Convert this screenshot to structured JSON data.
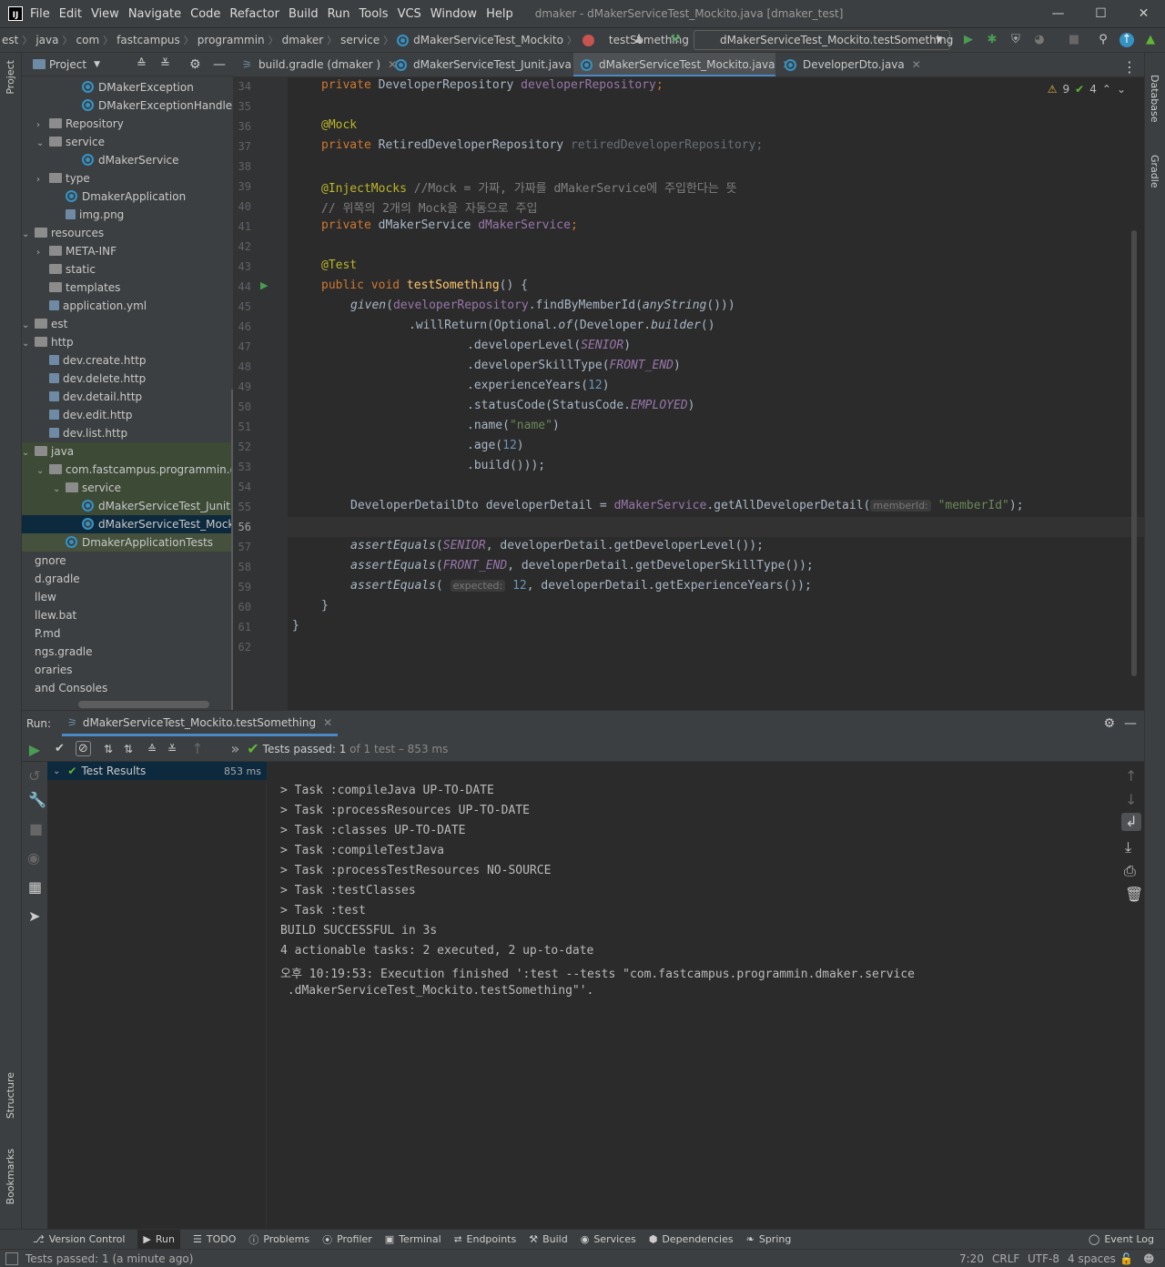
{
  "menubar": {
    "items": [
      "File",
      "Edit",
      "View",
      "Navigate",
      "Code",
      "Refactor",
      "Build",
      "Run",
      "Tools",
      "VCS",
      "Window",
      "Help"
    ],
    "title": "dmaker - dMakerServiceTest_Mockito.java [dmaker_test]"
  },
  "navbar": {
    "crumbs": [
      "est",
      "java",
      "com",
      "fastcampus",
      "programmin",
      "dmaker",
      "service",
      "dMakerServiceTest_Mockito",
      "testSomething"
    ],
    "run_config": "dMakerServiceTest_Mockito.testSomething"
  },
  "leftstrip": {
    "project": "Project",
    "structure": "Structure",
    "bookmarks": "Bookmarks"
  },
  "rightstrip": {
    "database": "Database",
    "gradle": "Gradle"
  },
  "project": {
    "title": "Project",
    "rows": [
      {
        "label": "DMakerException",
        "type": "class"
      },
      {
        "label": "DMakerExceptionHandler",
        "type": "class"
      },
      {
        "label": "Repository",
        "type": "folder"
      },
      {
        "label": "service",
        "type": "folder"
      },
      {
        "label": "dMakerService",
        "type": "class"
      },
      {
        "label": "type",
        "type": "folder"
      },
      {
        "label": "DmakerApplication",
        "type": "class"
      },
      {
        "label": "img.png",
        "type": "file"
      },
      {
        "label": "resources",
        "type": "folder"
      },
      {
        "label": "META-INF",
        "type": "folder"
      },
      {
        "label": "static",
        "type": "folder"
      },
      {
        "label": "templates",
        "type": "folder"
      },
      {
        "label": "application.yml",
        "type": "file"
      },
      {
        "label": "est",
        "type": "folder"
      },
      {
        "label": "http",
        "type": "folder"
      },
      {
        "label": "dev.create.http",
        "type": "file"
      },
      {
        "label": "dev.delete.http",
        "type": "file"
      },
      {
        "label": "dev.detail.http",
        "type": "file"
      },
      {
        "label": "dev.edit.http",
        "type": "file"
      },
      {
        "label": "dev.list.http",
        "type": "file"
      },
      {
        "label": "java",
        "type": "folder"
      },
      {
        "label": "com.fastcampus.programmin.dmaker",
        "type": "folder"
      },
      {
        "label": "service",
        "type": "folder"
      },
      {
        "label": "dMakerServiceTest_Junit",
        "type": "class"
      },
      {
        "label": "dMakerServiceTest_Mockito",
        "type": "class"
      },
      {
        "label": "DmakerApplicationTests",
        "type": "class"
      },
      {
        "label": "gnore",
        "type": "file"
      },
      {
        "label": "d.gradle",
        "type": "file"
      },
      {
        "label": "llew",
        "type": "file"
      },
      {
        "label": "llew.bat",
        "type": "file"
      },
      {
        "label": "P.md",
        "type": "file"
      },
      {
        "label": "ngs.gradle",
        "type": "file"
      },
      {
        "label": "oraries",
        "type": "file"
      },
      {
        "label": "and Consoles",
        "type": "file"
      }
    ]
  },
  "tabs": [
    "build.gradle (dmaker )",
    "dMakerServiceTest_Junit.java",
    "dMakerServiceTest_Mockito.java",
    "DeveloperDto.java"
  ],
  "editor": {
    "warnings": "9",
    "ok": "4",
    "line_numbers": [
      "34",
      "35",
      "36",
      "37",
      "38",
      "39",
      "40",
      "41",
      "42",
      "43",
      "44",
      "45",
      "46",
      "47",
      "48",
      "49",
      "50",
      "51",
      "52",
      "53",
      "54",
      "55",
      "56",
      "57",
      "58",
      "59",
      "60",
      "61",
      "62"
    ],
    "code": {
      "l34a": "private ",
      "l34b": "DeveloperRepository ",
      "l34c": "developerRepository",
      "l36": "@Mock",
      "l37a": "private ",
      "l37b": "RetiredDeveloperRepository ",
      "l37c": "retiredDeveloperRepository",
      "l39a": "@InjectMocks ",
      "l39b": "//Mock = 가짜, 가짜를 dMakerService에 주입한다는 뜻",
      "l40": "// 위쪽의 2개의 Mock을 자동으로 주입",
      "l41a": "private ",
      "l41b": "dMakerService ",
      "l41c": "dMakerService",
      "l43": "@Test",
      "l44a": "public void ",
      "l44b": "testSomething",
      "l44c": "() {",
      "l45a": "given",
      "l45b": "(",
      "l45c": "developerRepository",
      ".l45d": "",
      "l45d": ".findByMemberId(",
      "l45e": "anyString",
      "l45f": "()))",
      "l46a": ".willReturn(Optional.",
      "l46b": "of",
      "l46c": "(Developer.",
      "l46d": "builder",
      "l46e": "()",
      "l47a": ".developerLevel(",
      "l47b": "SENIOR",
      "l47c": ")",
      "l48a": ".developerSkillType(",
      "l48b": "FRONT_END",
      "l48c": ")",
      "l49a": ".experienceYears(",
      "l49b": "12",
      "l49c": ")",
      "l50a": ".statusCode(StatusCode.",
      "l50b": "EMPLOYED",
      "l50c": ")",
      "l51a": ".name(",
      "l51b": "\"name\"",
      "l51c": ")",
      "l52a": ".age(",
      "l52b": "12",
      "l52c": ")",
      "l53": ".build()));",
      "l55a": "DeveloperDetailDto developerDetail = ",
      "l55b": "dMakerService",
      "l55c": ".getAllDeveloperDetail(",
      "l55h": "memberId:",
      "l55d": "\"memberId\"",
      "l55e": ");",
      "l57a": "assertEquals",
      "l57b": "(",
      "l57c": "SENIOR",
      "l57d": ", developerDetail.getDeveloperLevel());",
      "l58a": "assertEquals",
      "l58b": "(",
      "l58c": "FRONT_END",
      "l58d": ", developerDetail.getDeveloperSkillType());",
      "l59a": "assertEquals",
      "l59b": "( ",
      "l59h": "expected:",
      "l59c": "12",
      ",l59d": "",
      "l59d": ", developerDetail.getExperienceYears());",
      "l60": "}",
      "l61": "}"
    }
  },
  "run": {
    "label": "Run:",
    "tab": "dMakerServiceTest_Mockito.testSomething",
    "status_prefix": "Tests passed: ",
    "passed": "1",
    "of": " of ",
    "total": "1",
    "rest": " test – 853 ms",
    "tree_root": "Test Results",
    "tree_time": "853 ms",
    "console": [
      "> Task :compileJava UP-TO-DATE",
      "> Task :processResources UP-TO-DATE",
      "> Task :classes UP-TO-DATE",
      "> Task :compileTestJava",
      "> Task :processTestResources NO-SOURCE",
      "> Task :testClasses",
      "> Task :test",
      "BUILD SUCCESSFUL in 3s",
      "4 actionable tasks: 2 executed, 2 up-to-date",
      "오후 10:19:53: Execution finished ':test --tests \"com.fastcampus.programmin.dmaker.service",
      " .dMakerServiceTest_Mockito.testSomething\"'."
    ]
  },
  "bottomtabs": [
    "Version Control",
    "Run",
    "TODO",
    "Problems",
    "Profiler",
    "Terminal",
    "Endpoints",
    "Build",
    "Services",
    "Dependencies",
    "Spring",
    "Event Log"
  ],
  "status": {
    "message": "Tests passed: 1 (a minute ago)",
    "position": "7:20",
    "line_sep": "CRLF",
    "encoding": "UTF-8",
    "indent": "4 spaces"
  },
  "colors": {
    "accent": "#4a88c7",
    "pass": "#5fb832",
    "warn": "#e0b542",
    "run": "#499c54"
  }
}
